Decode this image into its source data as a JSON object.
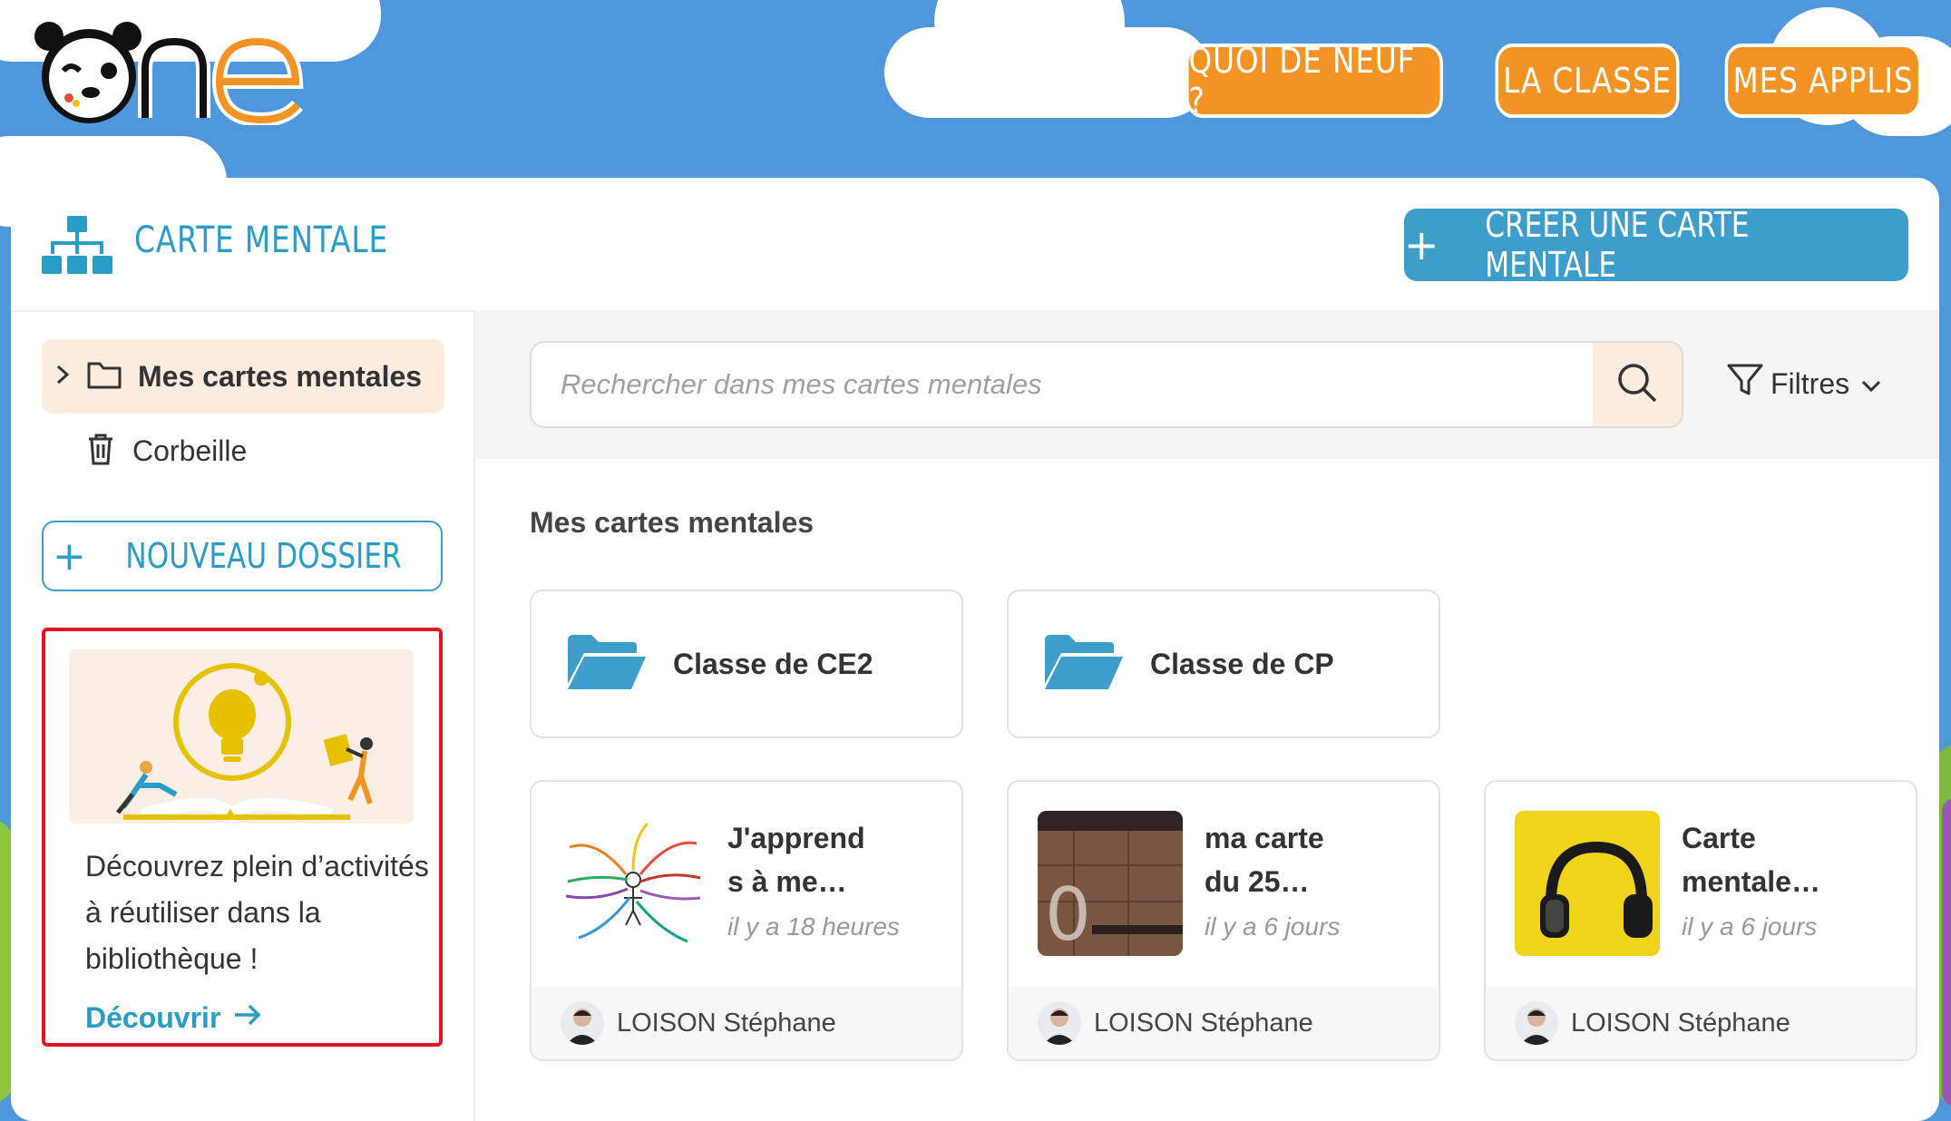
{
  "header": {
    "logo_text": "One",
    "nav": [
      "QUOI DE NEUF ?",
      "LA CLASSE",
      "MES APPLIS"
    ]
  },
  "app": {
    "title": "CARTE MENTALE",
    "create_label": "CRÉER UNE CARTE MENTALE",
    "icon": "sitemap-icon"
  },
  "sidebar": {
    "items": [
      {
        "label": "Mes cartes mentales",
        "icon": "folder-icon",
        "active": true
      },
      {
        "label": "Corbeille",
        "icon": "trash-icon",
        "active": false
      }
    ],
    "new_folder_label": "NOUVEAU DOSSIER",
    "promo": {
      "text": "Découvrez plein d’activités à réutiliser dans la bibliothèque !",
      "link": "Découvrir"
    }
  },
  "search": {
    "placeholder": "Rechercher dans mes cartes mentales",
    "filters_label": "Filtres"
  },
  "main": {
    "section_title": "Mes cartes mentales",
    "folders": [
      {
        "name": "Classe de CE2"
      },
      {
        "name": "Classe de CP"
      }
    ],
    "cards": [
      {
        "title_line1": "J'apprend",
        "title_line2": "s à me…",
        "time": "il y a 18 heures",
        "author": "LOISON Stéphane"
      },
      {
        "title_line1": "ma carte",
        "title_line2": "du 25…",
        "time": "il y a 6 jours",
        "author": "LOISON Stéphane"
      },
      {
        "title_line1": "Carte",
        "title_line2": "mentale…",
        "time": "il y a 6 jours",
        "author": "LOISON Stéphane"
      }
    ]
  },
  "colors": {
    "accent_orange": "#f39323",
    "accent_blue": "#3e9ecb",
    "sky": "#4f97dc",
    "highlight_red": "#e5131d"
  }
}
